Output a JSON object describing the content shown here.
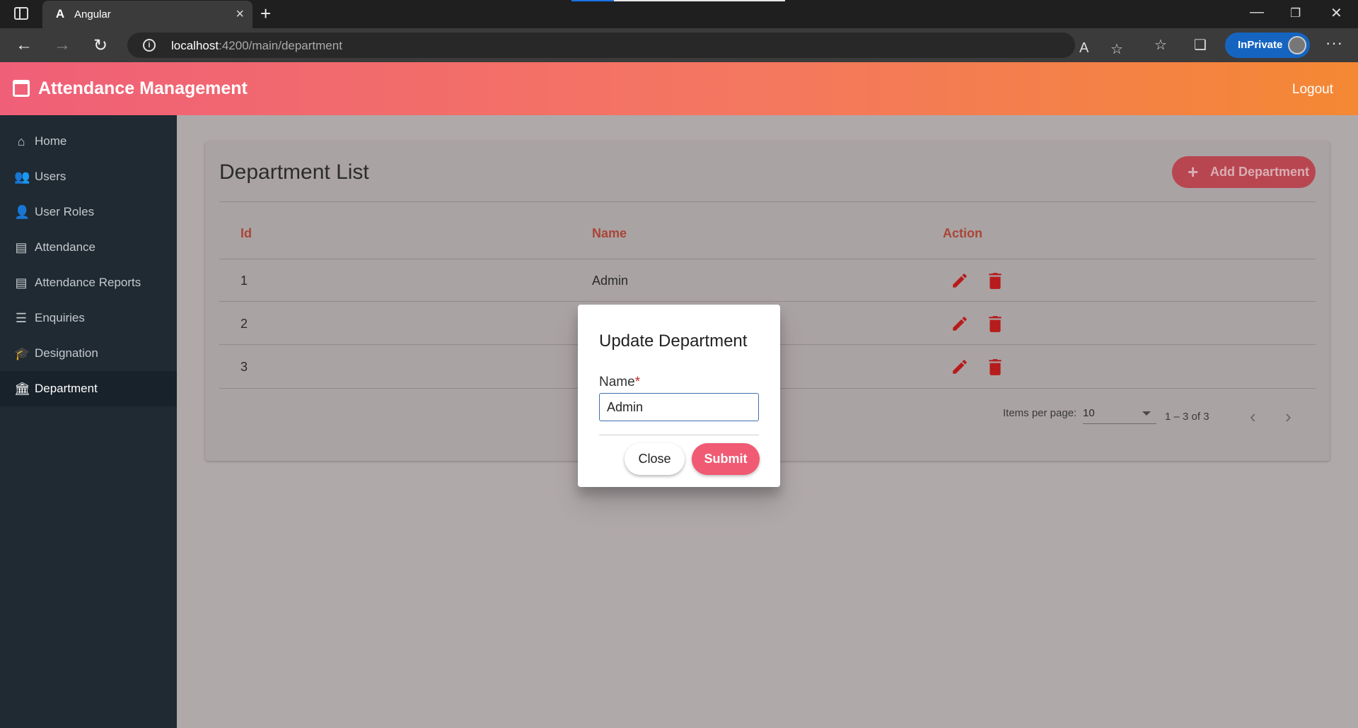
{
  "browser": {
    "tab_title": "Angular",
    "tab_logo": "A",
    "url_host": "localhost",
    "url_rest": ":4200/main/department",
    "inprivate_label": "InPrivate"
  },
  "header": {
    "title": "Attendance Management",
    "logout_label": "Logout"
  },
  "sidebar": {
    "items": [
      {
        "label": "Home",
        "icon": "home-icon"
      },
      {
        "label": "Users",
        "icon": "users-icon"
      },
      {
        "label": "User Roles",
        "icon": "user-roles-icon"
      },
      {
        "label": "Attendance",
        "icon": "attendance-icon"
      },
      {
        "label": "Attendance Reports",
        "icon": "reports-icon"
      },
      {
        "label": "Enquiries",
        "icon": "enquiries-icon"
      },
      {
        "label": "Designation",
        "icon": "designation-icon"
      },
      {
        "label": "Department",
        "icon": "department-icon",
        "active": true
      }
    ]
  },
  "main": {
    "title": "Department List",
    "add_button_label": "Add Department",
    "columns": [
      "Id",
      "Name",
      "Action"
    ],
    "rows": [
      {
        "id": "1",
        "name": "Admin"
      },
      {
        "id": "2",
        "name": ""
      },
      {
        "id": "3",
        "name": ""
      }
    ],
    "paginator": {
      "items_per_page_label": "Items per page:",
      "items_per_page_value": "10",
      "range_label": "1 – 3 of 3"
    }
  },
  "dialog": {
    "title": "Update Department",
    "field_label": "Name",
    "required_mark": "*",
    "field_value": "Admin",
    "close_label": "Close",
    "submit_label": "Submit"
  },
  "colors": {
    "accent": "#f05a72",
    "header_gradient_start": "#f05f78",
    "header_gradient_end": "#f48834",
    "sidebar_bg": "#1f2a33",
    "table_header_text": "#a94538",
    "action_icon": "#b71c1c"
  }
}
